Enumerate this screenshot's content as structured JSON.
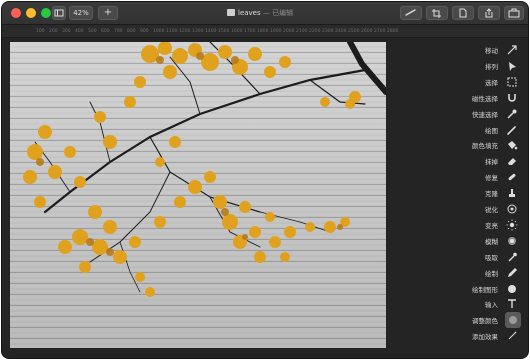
{
  "toolbar": {
    "zoom_label": "42%",
    "add_label": "+"
  },
  "title": {
    "doc_name": "leaves",
    "status": "— 已编辑"
  },
  "ruler": {
    "ticks": [
      "100",
      "200",
      "300",
      "400",
      "500",
      "600",
      "700",
      "800",
      "900",
      "1000",
      "1100",
      "1200",
      "1300",
      "1400",
      "1500",
      "1600",
      "1700",
      "1800",
      "1900",
      "2000",
      "2100",
      "2200",
      "2300",
      "2400",
      "2500",
      "2600",
      "2700",
      "2800"
    ]
  },
  "sidebar": {
    "tools": [
      {
        "label": "移动",
        "icon": "move-arrow-icon"
      },
      {
        "label": "排列",
        "icon": "pointer-icon"
      },
      {
        "label": "选择",
        "icon": "rect-select-icon"
      },
      {
        "label": "磁性选择",
        "icon": "magnet-icon"
      },
      {
        "label": "快速选择",
        "icon": "quick-select-icon"
      },
      {
        "label": "绘图",
        "icon": "brush-icon"
      },
      {
        "label": "颜色填充",
        "icon": "paint-bucket-icon"
      },
      {
        "label": "抹掉",
        "icon": "eraser-icon"
      },
      {
        "label": "修复",
        "icon": "bandage-icon"
      },
      {
        "label": "克隆",
        "icon": "clone-stamp-icon"
      },
      {
        "label": "锐化",
        "icon": "sharpen-icon"
      },
      {
        "label": "变亮",
        "icon": "sun-icon"
      },
      {
        "label": "模糊",
        "icon": "blur-icon"
      },
      {
        "label": "吸取",
        "icon": "dropper-icon"
      },
      {
        "label": "绘制",
        "icon": "pen-icon"
      },
      {
        "label": "绘制图形",
        "icon": "shape-icon"
      },
      {
        "label": "输入",
        "icon": "text-icon"
      },
      {
        "label": "调整颜色",
        "icon": "adjust-color-icon"
      },
      {
        "label": "添加效果",
        "icon": "effects-icon"
      }
    ]
  }
}
